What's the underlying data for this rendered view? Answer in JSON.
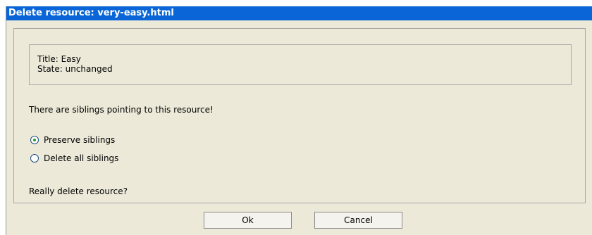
{
  "dialog": {
    "title": "Delete resource: very-easy.html",
    "info": {
      "title_line": "Title: Easy",
      "state_line": "State: unchanged"
    },
    "siblings_message": "There are siblings pointing to this resource!",
    "options": [
      {
        "label": "Preserve siblings",
        "selected": true
      },
      {
        "label": "Delete all siblings",
        "selected": false
      }
    ],
    "confirm_question": "Really delete resource?",
    "buttons": {
      "ok_label": "Ok",
      "cancel_label": "Cancel"
    }
  }
}
